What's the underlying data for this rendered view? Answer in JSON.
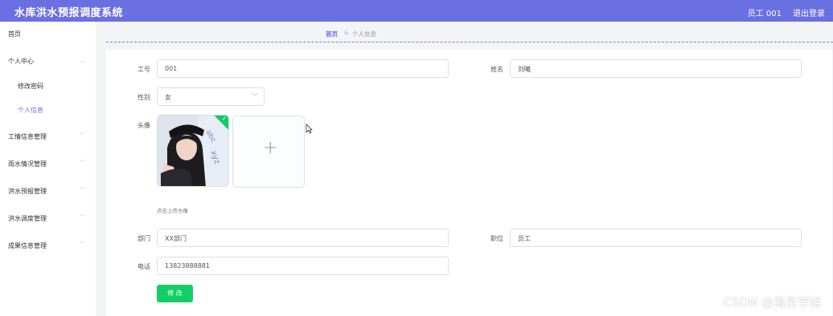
{
  "app": {
    "title": "水库洪水预报调度系统"
  },
  "header": {
    "user": "员工 001",
    "logout": "退出登录"
  },
  "sidebar": {
    "items": [
      {
        "label": "首页"
      },
      {
        "label": "个人中心"
      },
      {
        "label": "修改密码"
      },
      {
        "label": "个人信息"
      },
      {
        "label": "工情信息管理"
      },
      {
        "label": "雨水情况管理"
      },
      {
        "label": "洪水预报管理"
      },
      {
        "label": "洪水调度管理"
      },
      {
        "label": "成果信息管理"
      }
    ],
    "active": "个人信息"
  },
  "breadcrumb": {
    "home": "首页",
    "separator": "&",
    "current": "个人信息"
  },
  "form": {
    "employee_id": {
      "label": "工号",
      "value": "001"
    },
    "name": {
      "label": "姓名",
      "value": "刘曦"
    },
    "gender": {
      "label": "性别",
      "value": "女"
    },
    "avatar": {
      "label": "头像",
      "hint": "点击上传头像"
    },
    "department": {
      "label": "部门",
      "value": "XX部门"
    },
    "position": {
      "label": "职位",
      "value": "员工"
    },
    "phone": {
      "label": "电话",
      "value": "13823888881"
    },
    "submit_label": "修 改"
  },
  "watermark": "CSDN @海灵学姐",
  "colors": {
    "primary": "#6a70e2",
    "success": "#13ce66"
  }
}
